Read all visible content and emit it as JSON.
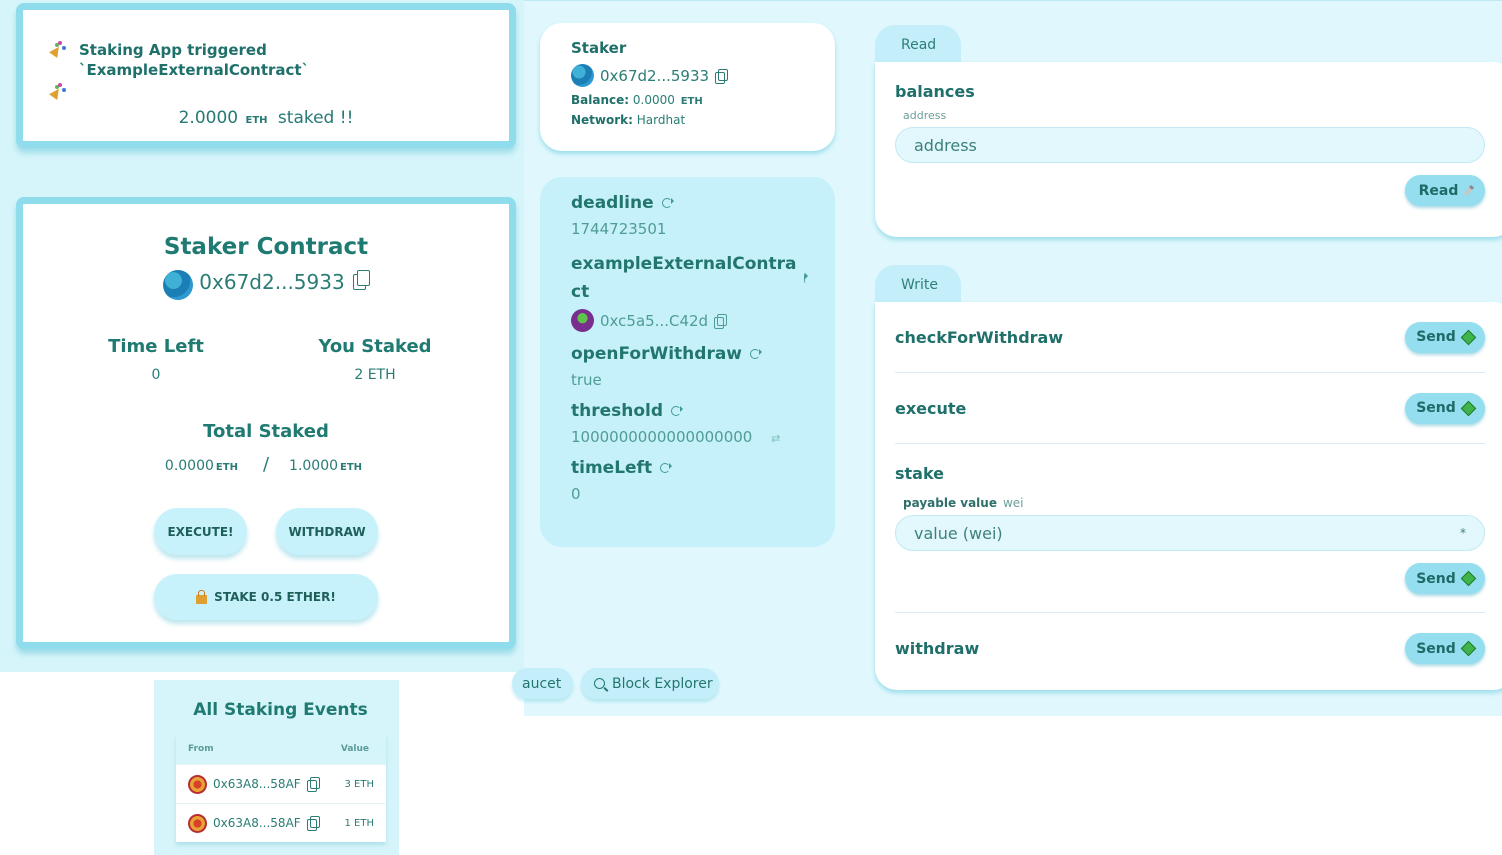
{
  "colors": {
    "accent": "#94def0",
    "panel_bg": "#c6f1fb",
    "text": "#1f6f6a",
    "card_border": "#8fdcec"
  },
  "notice": {
    "message": "Staking App triggered `ExampleExternalContract`",
    "icon": "party-popper-icon",
    "staked_amount": "2.0000",
    "staked_unit": "ETH",
    "staked_suffix": "staked !!"
  },
  "contract": {
    "title": "Staker Contract",
    "address": "0x67d2...5933",
    "time_left_label": "Time Left",
    "time_left_value": "0",
    "you_staked_label": "You Staked",
    "you_staked_value": "2 ETH",
    "total_staked_label": "Total Staked",
    "total_staked_value": "0.0000",
    "threshold_value": "1.0000",
    "eth_unit": "ETH",
    "separator": "/",
    "execute_label": "EXECUTE!",
    "withdraw_label": "WITHDRAW",
    "stake_label": "STAKE 0.5 ETHER!"
  },
  "events": {
    "title": "All Staking Events",
    "columns": [
      "From",
      "Value"
    ],
    "rows": [
      {
        "from": "0x63A8...58AF",
        "value": "3 ETH"
      },
      {
        "from": "0x63A8...58AF",
        "value": "1 ETH"
      }
    ]
  },
  "staker": {
    "title": "Staker",
    "address": "0x67d2...5933",
    "balance_label": "Balance:",
    "balance_value": "0.0000",
    "balance_unit": "ETH",
    "network_label": "Network:",
    "network_value": "Hardhat"
  },
  "variables": {
    "deadline": {
      "name": "deadline",
      "value": "1744723501"
    },
    "example": {
      "name_line1": "exampleExternalContra",
      "name_line2": "ct",
      "value": "0xc5a5...C42d"
    },
    "open": {
      "name": "openForWithdraw",
      "value": "true"
    },
    "threshold": {
      "name": "threshold",
      "value": "1000000000000000000",
      "swap": "⇄"
    },
    "timeleft": {
      "name": "timeLeft",
      "value": "0"
    }
  },
  "footer": {
    "faucet_label": "aucet",
    "explorer_label": "Block Explorer"
  },
  "read": {
    "tab_label": "Read",
    "function_name": "balances",
    "field_label": "address",
    "placeholder": "address",
    "button_label": "Read"
  },
  "write": {
    "tab_label": "Write",
    "check_name": "checkForWithdraw",
    "execute_name": "execute",
    "stake_name": "stake",
    "payable_label": "payable value",
    "payable_unit": "wei",
    "stake_placeholder": "value (wei)",
    "stake_star": "*",
    "withdraw_name": "withdraw",
    "send_label": "Send"
  }
}
